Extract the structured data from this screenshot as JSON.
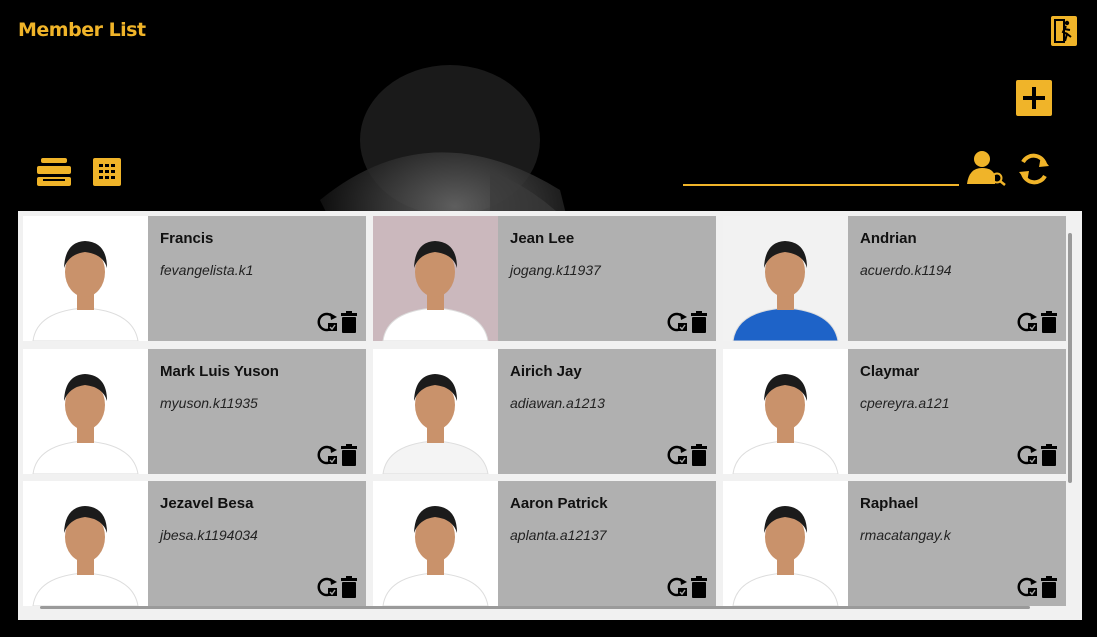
{
  "app": {
    "title": "Member List"
  },
  "toolbar": {
    "exit_icon": "exit-run-icon",
    "add_icon": "plus-icon",
    "list_view_icon": "list-view-icon",
    "grid_view_icon": "grid-view-icon",
    "search_icon": "user-search-icon",
    "refresh_icon": "refresh-icon",
    "search_value": ""
  },
  "colors": {
    "accent": "#f0b429",
    "card_bg": "#aaaaaa",
    "background": "#000000"
  },
  "members": [
    {
      "name": "Francis",
      "username": "fevangelista.k1",
      "shirt": "#ffffff",
      "bg": "#ffffff"
    },
    {
      "name": "Jean Lee",
      "username": "jogang.k11937",
      "shirt": "#ffffff",
      "bg": "#cbb8bd"
    },
    {
      "name": "Andrian",
      "username": "acuerdo.k1194",
      "shirt": "#1e63c8",
      "bg": "#f2f2f2"
    },
    {
      "name": "Mark Luis Yuson",
      "username": "myuson.k11935",
      "shirt": "#ffffff",
      "bg": "#ffffff"
    },
    {
      "name": "Airich Jay",
      "username": "adiawan.a1213",
      "shirt": "#f4f4f4",
      "bg": "#ffffff"
    },
    {
      "name": "Claymar",
      "username": "cpereyra.a121",
      "shirt": "#ffffff",
      "bg": "#ffffff"
    },
    {
      "name": "Jezavel Besa",
      "username": "jbesa.k1194034",
      "shirt": "#ffffff",
      "bg": "#ffffff"
    },
    {
      "name": "Aaron Patrick",
      "username": "aplanta.a12137",
      "shirt": "#ffffff",
      "bg": "#ffffff"
    },
    {
      "name": "Raphael",
      "username": "rmacatangay.k",
      "shirt": "#ffffff",
      "bg": "#ffffff"
    }
  ],
  "card_actions": {
    "reset_icon": "reset-password-icon",
    "delete_icon": "trash-icon"
  }
}
